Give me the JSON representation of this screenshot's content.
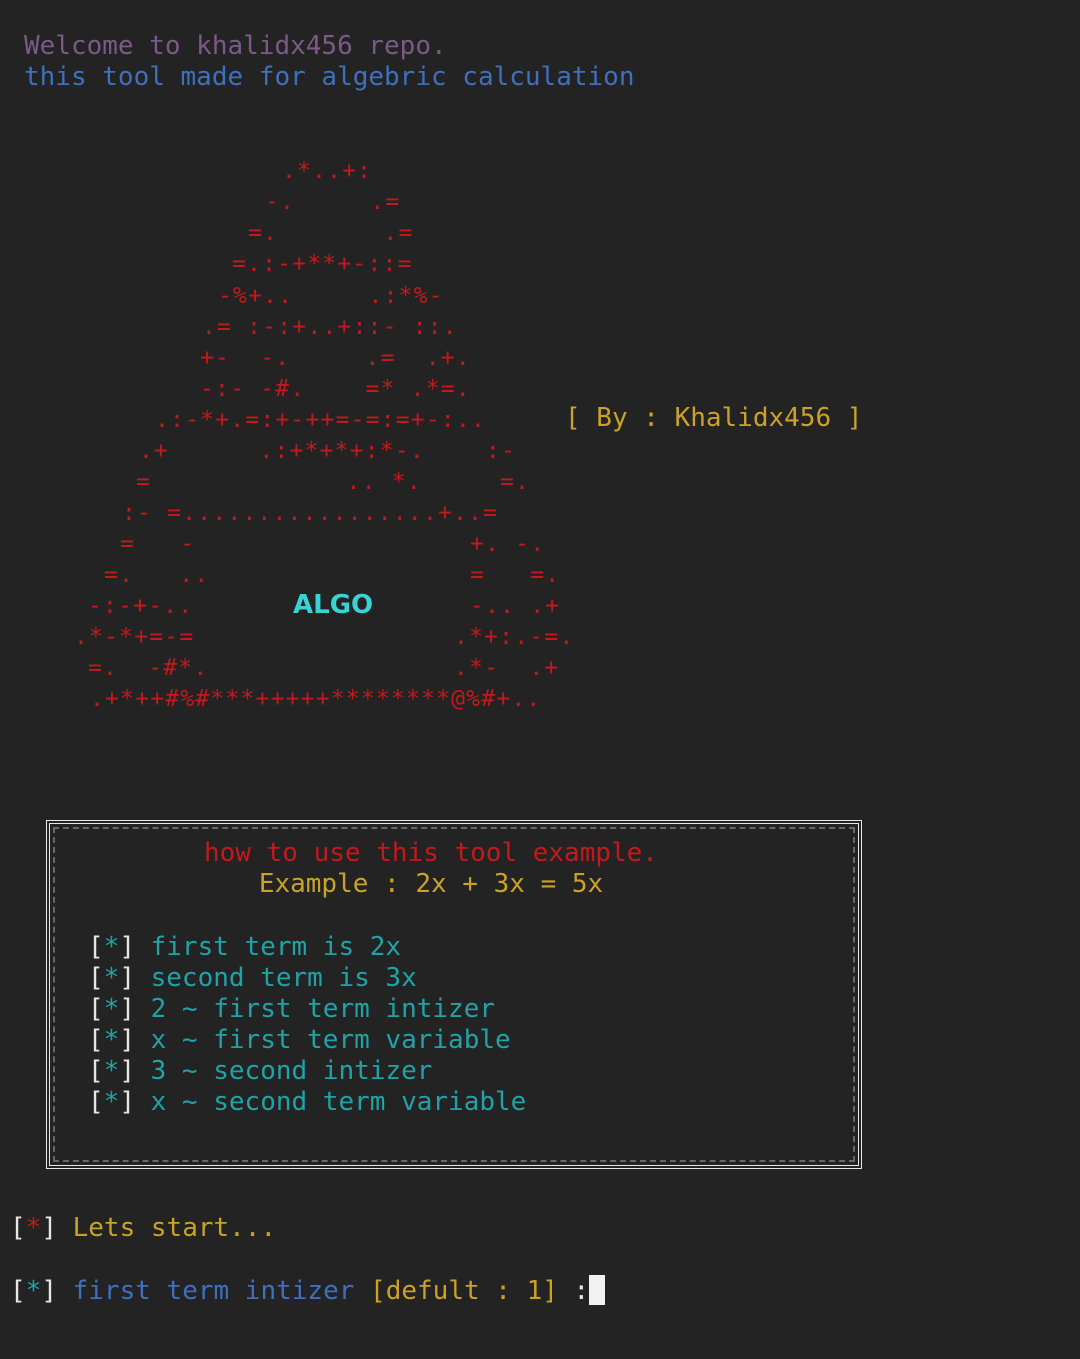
{
  "header": {
    "welcome": "Welcome to khalidx456 repo.",
    "subtitle": "this tool made for algebric calculation"
  },
  "banner": {
    "logo_text": "ALGO",
    "byline": "[ By : Khalidx456 ]",
    "art_lines": [
      ".*..+:",
      "-.     .=",
      "=.       .=",
      "=.:-+**+-::=",
      "-%+..     .:*%-",
      ".= :-:+..+::- ::.",
      "+-  -.     .=  .+.",
      "-:- -#.    =* .*=.",
      ".:-*+.=:+-++=-=:=+-:..",
      ".+      .:+*+*+:*-.",
      "=             .. *.",
      ":- =.................+..=",
      "=   -",
      "=.   ..",
      "-:-+-..",
      ".*-*+=-=",
      "=.  -#*.",
      ".+*++#%#***+++++********@%#+..",
      ":-",
      "=.",
      "+. -.",
      "=   =.",
      "-.. .+",
      ".*+:.-=.",
      ".*-  .+"
    ]
  },
  "usage": {
    "title": "how to use this tool example.",
    "example": "Example : 2x + 3x = 5x",
    "bracket_open": "[",
    "bracket_close": "]",
    "star": "*",
    "items": [
      "first term is 2x",
      "second term is 3x",
      "2 ~ first term intizer",
      "x ~ first term variable",
      "3 ~ second intizer",
      "x ~ second term variable"
    ]
  },
  "console": {
    "start_text": "Lets start...",
    "prompt_text": "first term intizer",
    "prompt_default": "[defult : 1]",
    "prompt_colon": ":"
  },
  "colors": {
    "background": "#232323",
    "red": "#c4191c",
    "cyan": "#1fa3a6",
    "yellow": "#c9a227",
    "blue": "#3f6fbd",
    "purple": "#7a5a86"
  }
}
